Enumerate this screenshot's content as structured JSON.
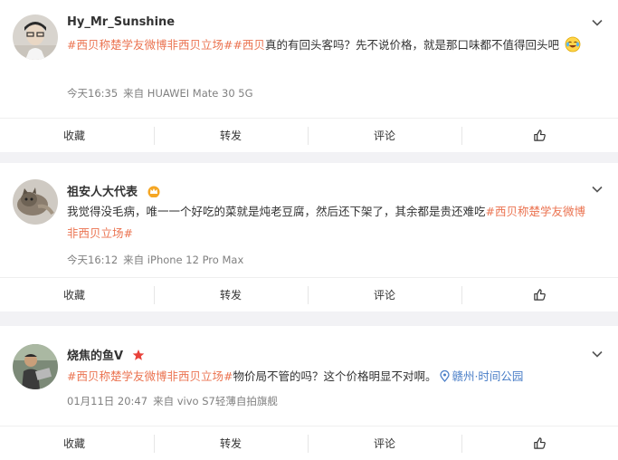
{
  "posts": [
    {
      "username": "Hy_Mr_Sunshine",
      "content_parts": [
        {
          "type": "tag",
          "text": "#西贝称楚学友微博非西贝立场#"
        },
        {
          "type": "tag",
          "text": "#西贝"
        },
        {
          "type": "text",
          "text": "真的有回头客吗？先不说价格，就是那口味都不值得回头吧"
        }
      ],
      "emoji_icon": "laughing-crying-emoji-icon",
      "time": "今天16:35",
      "source": "来自 HUAWEI Mate 30 5G",
      "actions": {
        "favorite": "收藏",
        "forward": "转发",
        "comment": "评论"
      }
    },
    {
      "username": "祖安人大代表",
      "badge_icon": "crown-icon",
      "content_parts": [
        {
          "type": "text",
          "text": "我觉得没毛病，唯一一个好吃的菜就是炖老豆腐，然后还下架了，其余都是贵还难吃"
        },
        {
          "type": "tag",
          "text": "#西贝称楚学友微博非西贝立场#"
        }
      ],
      "time": "今天16:12",
      "source": "来自 iPhone 12 Pro Max",
      "actions": {
        "favorite": "收藏",
        "forward": "转发",
        "comment": "评论"
      }
    },
    {
      "username": "烧焦的鱼V",
      "badge_icon": "star-icon",
      "content_parts": [
        {
          "type": "tag",
          "text": "#西贝称楚学友微博非西贝立场#"
        },
        {
          "type": "text",
          "text": "物价局不管的吗？这个价格明显不对啊。 "
        }
      ],
      "location": "赣州·时间公园",
      "time": "01月11日 20:47",
      "source": "来自 vivo S7轻薄自拍旗舰",
      "actions": {
        "favorite": "收藏",
        "forward": "转发",
        "comment": "评论"
      }
    }
  ],
  "colors": {
    "topic_tag": "#eb7350",
    "location_link": "#4a7ec7",
    "meta_text": "#808080",
    "background": "#f2f2f5"
  }
}
